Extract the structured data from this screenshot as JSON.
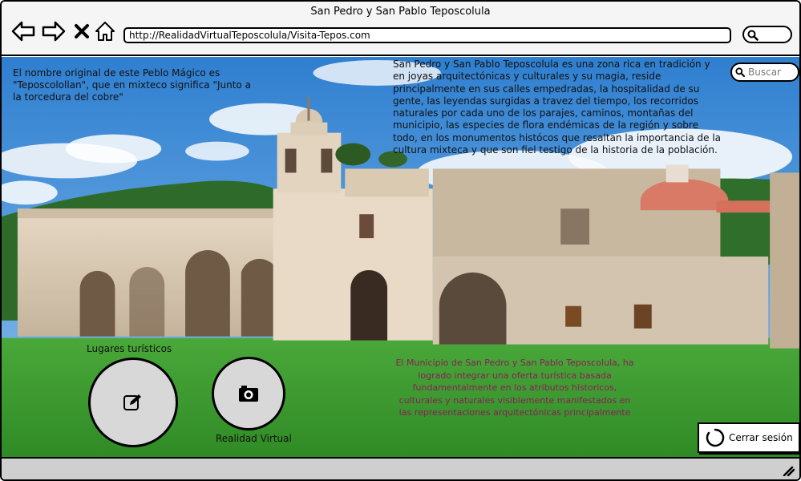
{
  "window": {
    "title": "San Pedro y San Pablo Teposcolula"
  },
  "nav": {
    "back_icon": "arrow-left-icon",
    "forward_icon": "arrow-right-icon",
    "close_icon": "close-icon",
    "home_icon": "home-icon"
  },
  "address_bar": {
    "url": "http://RealidadVirtualTeposcolula/Visita-Tepos.com"
  },
  "intro_left": "El nombre original de este Peblo Mágico es \"Teposcolollan\", que en mixteco significa \"Junto a la torcedura del cobre\"",
  "intro_right": "San Pedro y San Pablo Teposcolula es una zona rica en tradición y en joyas arquitectónicas y culturales y su magia, reside principalmente en sus calles empedradas, la hospitalidad de su gente, las leyendas surgidas a travez del tiempo, los recorridos naturales por cada uno de los parajes, caminos, montañas del municipio, las especies de flora endémicas de la región y sobre todo, en los monumentos histócos que resaltan la importancia de la cultura mixteca y que son fiel testigo de la historia de la población.",
  "search": {
    "placeholder": "Buscar"
  },
  "municipio_text": "El Municipio de San Pedro y San Pablo Teposcolula, ha logrado integrar una oferta turística  basada fundamentalmente en los atributos historicos, culturales y naturales visiblemente manifestados en las representaciones arquitectónicas principalmente",
  "actions": {
    "tourist_places_label": "Lugares turísticos",
    "virtual_reality_label": "Realidad Virtual",
    "logout_label": "Cerrar sesión"
  },
  "colors": {
    "accent_text": "#8a1f5a",
    "sky": "#4a8fd6",
    "grass": "#3c9b2c",
    "stone": "#d9cbb6"
  }
}
